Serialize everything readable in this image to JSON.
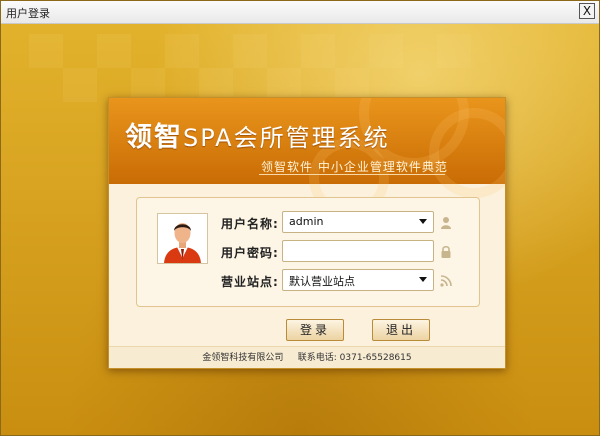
{
  "window": {
    "title": "用户登录",
    "close_symbol": "X"
  },
  "header": {
    "brand": "领智",
    "system_name": "SPA会所管理系统",
    "slogan": "领智软件 中小企业管理软件典范"
  },
  "form": {
    "username_label": "用户名称:",
    "username_value": "admin",
    "password_label": "用户密码:",
    "password_value": "",
    "site_label": "营业站点:",
    "site_value": "默认营业站点"
  },
  "buttons": {
    "login": "登录",
    "exit": "退出"
  },
  "footer": {
    "company": "金领智科技有限公司",
    "phone_label": "联系电话:",
    "phone": "0371-65528615"
  },
  "icons": {
    "close": "close-icon",
    "user_field": "person-icon",
    "password_field": "lock-icon",
    "site_field": "rss-feed-icon",
    "avatar": "user-avatar-icon"
  },
  "colors": {
    "accent": "#d98a12",
    "banner": "#c96c05",
    "background": "#d9a520"
  }
}
